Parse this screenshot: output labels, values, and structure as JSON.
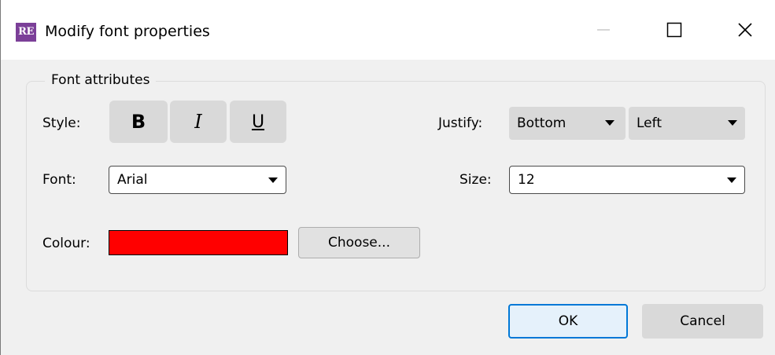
{
  "window": {
    "title": "Modify font properties",
    "icon_text": "RE"
  },
  "group": {
    "legend": "Font attributes"
  },
  "style": {
    "label": "Style:",
    "bold": "B",
    "italic": "I",
    "underline": "U"
  },
  "justify": {
    "label": "Justify:",
    "vertical": "Bottom",
    "horizontal": "Left"
  },
  "font": {
    "label": "Font:",
    "value": "Arial"
  },
  "size": {
    "label": "Size:",
    "value": "12"
  },
  "colour": {
    "label": "Colour:",
    "swatch": "#ff0000",
    "choose_label": "Choose..."
  },
  "buttons": {
    "ok": "OK",
    "cancel": "Cancel"
  },
  "colors": {
    "accent": "#0078d7",
    "app_icon": "#7b3f98"
  }
}
